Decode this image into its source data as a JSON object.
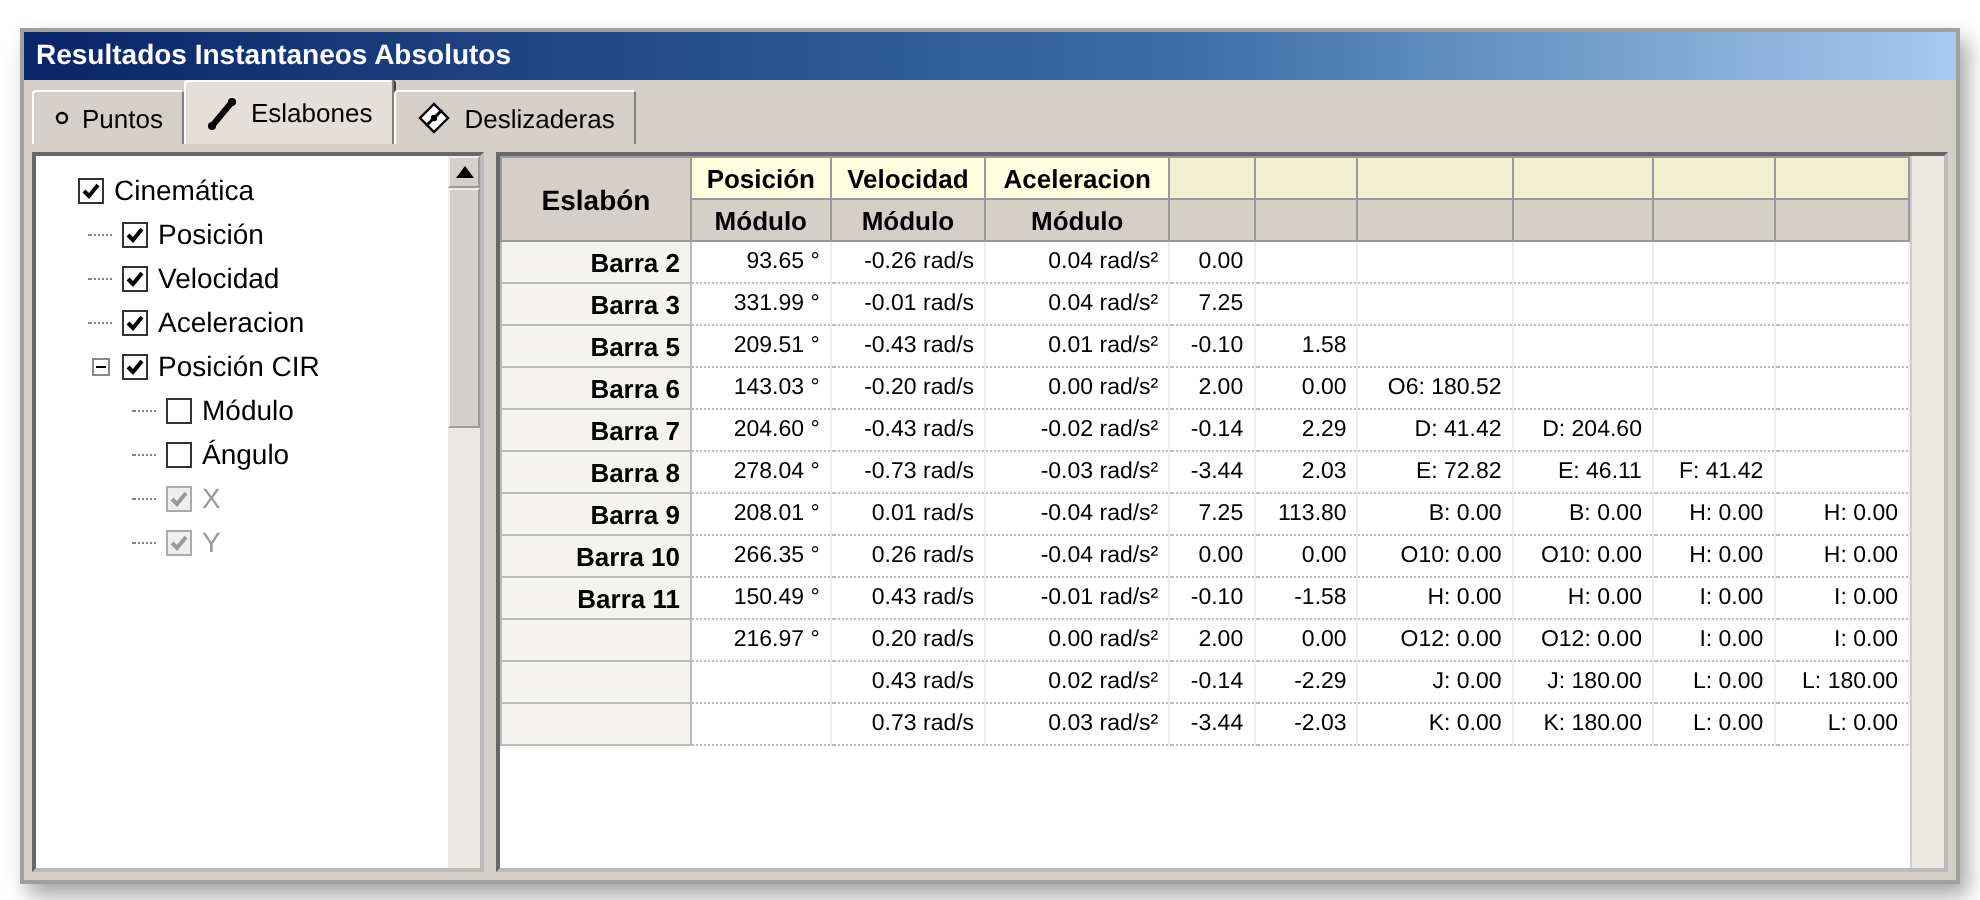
{
  "window": {
    "title": "Resultados Instantaneos Absolutos"
  },
  "tabs": [
    {
      "label": "Puntos",
      "kind": "point",
      "selected": false
    },
    {
      "label": "Eslabones",
      "kind": "link",
      "selected": true
    },
    {
      "label": "Deslizaderas",
      "kind": "slider",
      "selected": false
    }
  ],
  "tree": [
    {
      "label": "Cinemática",
      "checked": true,
      "disabled": false,
      "children": [
        {
          "label": "Posición",
          "checked": true,
          "disabled": false
        },
        {
          "label": "Velocidad",
          "checked": true,
          "disabled": false
        },
        {
          "label": "Aceleracion",
          "checked": true,
          "disabled": false
        },
        {
          "label": "Posición CIR",
          "checked": true,
          "disabled": false,
          "expanded": true,
          "children": [
            {
              "label": "Módulo",
              "checked": false,
              "disabled": false
            },
            {
              "label": "Ángulo",
              "checked": false,
              "disabled": false
            },
            {
              "label": "X",
              "checked": true,
              "disabled": true
            },
            {
              "label": "Y",
              "checked": true,
              "disabled": true
            }
          ]
        }
      ]
    }
  ],
  "table": {
    "row_header": "Eslabón",
    "column_groups": [
      "Posición",
      "Velocidad",
      "Aceleracion"
    ],
    "columns": [
      "Módulo",
      "Módulo",
      "Módulo"
    ],
    "rows": [
      {
        "name": "Barra 2",
        "cells": [
          "93.65 °",
          "-0.26 rad/s",
          "0.04 rad/s²",
          "0.00",
          null,
          null,
          null,
          null,
          null
        ]
      },
      {
        "name": "Barra 3",
        "cells": [
          "331.99 °",
          "-0.01 rad/s",
          "0.04 rad/s²",
          "7.25",
          null,
          null,
          null,
          null,
          null
        ]
      },
      {
        "name": "Barra 5",
        "cells": [
          "209.51 °",
          "-0.43 rad/s",
          "0.01 rad/s²",
          "-0.10",
          "1.58",
          null,
          null,
          null,
          null
        ]
      },
      {
        "name": "Barra 6",
        "cells": [
          "143.03 °",
          "-0.20 rad/s",
          "0.00 rad/s²",
          "2.00",
          "0.00",
          "O6: 180.52",
          null,
          null,
          null
        ]
      },
      {
        "name": "Barra 7",
        "cells": [
          "204.60 °",
          "-0.43 rad/s",
          "-0.02 rad/s²",
          "-0.14",
          "2.29",
          "D: 41.42",
          "D: 204.60",
          null,
          null
        ]
      },
      {
        "name": "Barra 8",
        "cells": [
          "278.04 °",
          "-0.73 rad/s",
          "-0.03 rad/s²",
          "-3.44",
          "2.03",
          "E: 72.82",
          "E: 46.11",
          "F: 41.42",
          null
        ]
      },
      {
        "name": "Barra 9",
        "cells": [
          "208.01 °",
          "0.01 rad/s",
          "-0.04 rad/s²",
          "7.25",
          "113.80",
          "B: 0.00",
          "B: 0.00",
          "H: 0.00",
          "H: 0.00"
        ]
      },
      {
        "name": "Barra 10",
        "cells": [
          "266.35 °",
          "0.26 rad/s",
          "-0.04 rad/s²",
          "0.00",
          "0.00",
          "O10: 0.00",
          "O10: 0.00",
          "H: 0.00",
          "H: 0.00"
        ]
      },
      {
        "name": "Barra 11",
        "cells": [
          "150.49 °",
          "0.43 rad/s",
          "-0.01 rad/s²",
          "-0.10",
          "-1.58",
          "H: 0.00",
          "H: 0.00",
          "I: 0.00",
          "I: 0.00"
        ]
      },
      {
        "name": null,
        "cells": [
          "216.97 °",
          "0.20 rad/s",
          "0.00 rad/s²",
          "2.00",
          "0.00",
          "O12: 0.00",
          "O12: 0.00",
          "I: 0.00",
          "I: 0.00"
        ]
      },
      {
        "name": null,
        "cells": [
          null,
          "0.43 rad/s",
          "0.02 rad/s²",
          "-0.14",
          "-2.29",
          "J: 0.00",
          "J: 180.00",
          "L: 0.00",
          "L: 180.00"
        ]
      },
      {
        "name": null,
        "cells": [
          null,
          "0.73 rad/s",
          "0.03 rad/s²",
          "-3.44",
          "-2.03",
          "K: 0.00",
          "K: 180.00",
          "L: 0.00",
          "L: 0.00"
        ]
      }
    ]
  }
}
